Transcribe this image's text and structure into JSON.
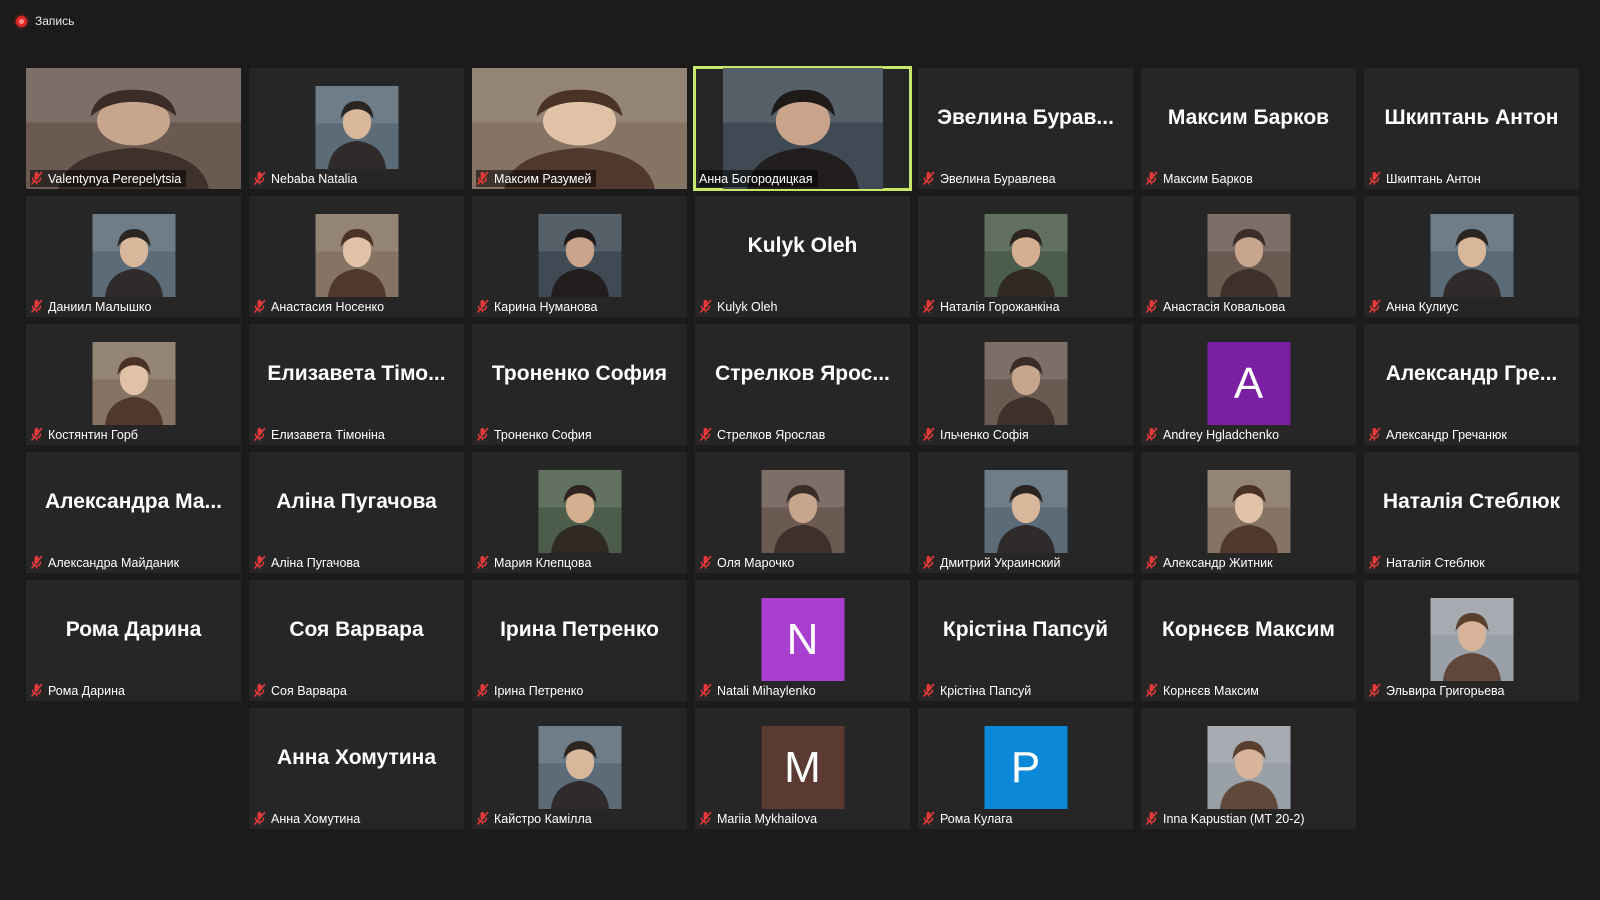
{
  "recording": {
    "label": "Запись",
    "indicator_color": "#e02828"
  },
  "active_speaker_color": "#c9e86a",
  "tiles": [
    {
      "name": "Valentynya Perepelytsia",
      "mode": "full",
      "active": false,
      "muted": true
    },
    {
      "name": "Nebaba Natalia",
      "mode": "thumb",
      "active": false,
      "muted": true
    },
    {
      "name": "Максим Разумей",
      "mode": "full",
      "active": false,
      "muted": true
    },
    {
      "name": "Анна Богородицкая",
      "mode": "wide",
      "active": true,
      "muted": false
    },
    {
      "name": "Эвелина Буравлева",
      "display": "Эвелина  Бурав...",
      "mode": "name",
      "muted": true
    },
    {
      "name": "Максим Барков",
      "display": "Максим Барков",
      "mode": "name",
      "muted": true
    },
    {
      "name": "Шкиптань Антон",
      "display": "Шкиптань Антон",
      "mode": "name",
      "muted": true
    },
    {
      "name": "Даниил Малышко",
      "mode": "thumb",
      "muted": true
    },
    {
      "name": "Анастасия Носенко",
      "mode": "thumb",
      "muted": true
    },
    {
      "name": "Карина Нуманова",
      "mode": "thumb",
      "muted": true
    },
    {
      "name": "Kulyk Oleh",
      "display": "Kulyk Oleh",
      "mode": "name",
      "muted": true
    },
    {
      "name": "Наталія Горожанкіна",
      "mode": "thumb",
      "muted": true
    },
    {
      "name": "Анастасія Ковальова",
      "mode": "thumb",
      "muted": true
    },
    {
      "name": "Анна Кулиус",
      "mode": "thumb",
      "muted": true
    },
    {
      "name": "Костянтин Горб",
      "mode": "thumb",
      "muted": true
    },
    {
      "name": "Елизавета Тімоніна",
      "display": "Елизавета  Тімо...",
      "mode": "name",
      "muted": true
    },
    {
      "name": "Троненко София",
      "display": "Троненко София",
      "mode": "name",
      "muted": true
    },
    {
      "name": "Стрелков Ярослав",
      "display": "Стрелков Ярос...",
      "mode": "name",
      "muted": true
    },
    {
      "name": "Ільченко Софія",
      "mode": "thumb",
      "muted": true
    },
    {
      "name": "Andrey Hgladchenko",
      "mode": "letter",
      "letter": "A",
      "color": "#7b1fa2",
      "muted": true
    },
    {
      "name": "Александр Гречанюк",
      "display": "Александр  Гре...",
      "mode": "name",
      "muted": true
    },
    {
      "name": "Александра Майданик",
      "display": "Александра  Ма...",
      "mode": "name",
      "muted": true
    },
    {
      "name": "Аліна Пугачова",
      "display": "Аліна Пугачова",
      "mode": "name",
      "muted": true
    },
    {
      "name": "Мария Клепцова",
      "mode": "thumb",
      "muted": true
    },
    {
      "name": "Оля Марочко",
      "mode": "thumb",
      "muted": true
    },
    {
      "name": "Дмитрий Украинский",
      "mode": "thumb",
      "muted": true
    },
    {
      "name": "Александр Житник",
      "mode": "thumb",
      "muted": true
    },
    {
      "name": "Наталія Стеблюк",
      "display": "Наталія Стеблюк",
      "mode": "name",
      "muted": true
    },
    {
      "name": "Рома Дарина",
      "display": "Рома Дарина",
      "mode": "name",
      "muted": true
    },
    {
      "name": "Соя Варвара",
      "display": "Соя Варвара",
      "mode": "name",
      "muted": true
    },
    {
      "name": "Ірина Петренко",
      "display": "Ірина Петренко",
      "mode": "name",
      "muted": true
    },
    {
      "name": "Natali Mihaylenko",
      "mode": "letter",
      "letter": "N",
      "color": "#a93fcf",
      "muted": true
    },
    {
      "name": "Крістіна Папсуй",
      "display": "Крістіна Папсуй",
      "mode": "name",
      "muted": true
    },
    {
      "name": "Корнєєв Максим",
      "display": "Корнєєв Максим",
      "mode": "name",
      "muted": true
    },
    {
      "name": "Эльвира Григорьева",
      "mode": "thumb",
      "muted": true
    },
    {
      "name": "",
      "mode": "empty"
    },
    {
      "name": "Анна Хомутина",
      "display": "Анна Хомутина",
      "mode": "name",
      "muted": true
    },
    {
      "name": "Кайстро Камілла",
      "mode": "thumb",
      "muted": true
    },
    {
      "name": "Mariia Mykhailova",
      "mode": "letter",
      "letter": "M",
      "color": "#5a3a31",
      "muted": true
    },
    {
      "name": "Рома Кулага",
      "mode": "letter",
      "letter": "P",
      "color": "#0b88d8",
      "muted": true
    },
    {
      "name": "Inna Kapustian (MT 20-2)",
      "mode": "thumb",
      "muted": true
    }
  ]
}
